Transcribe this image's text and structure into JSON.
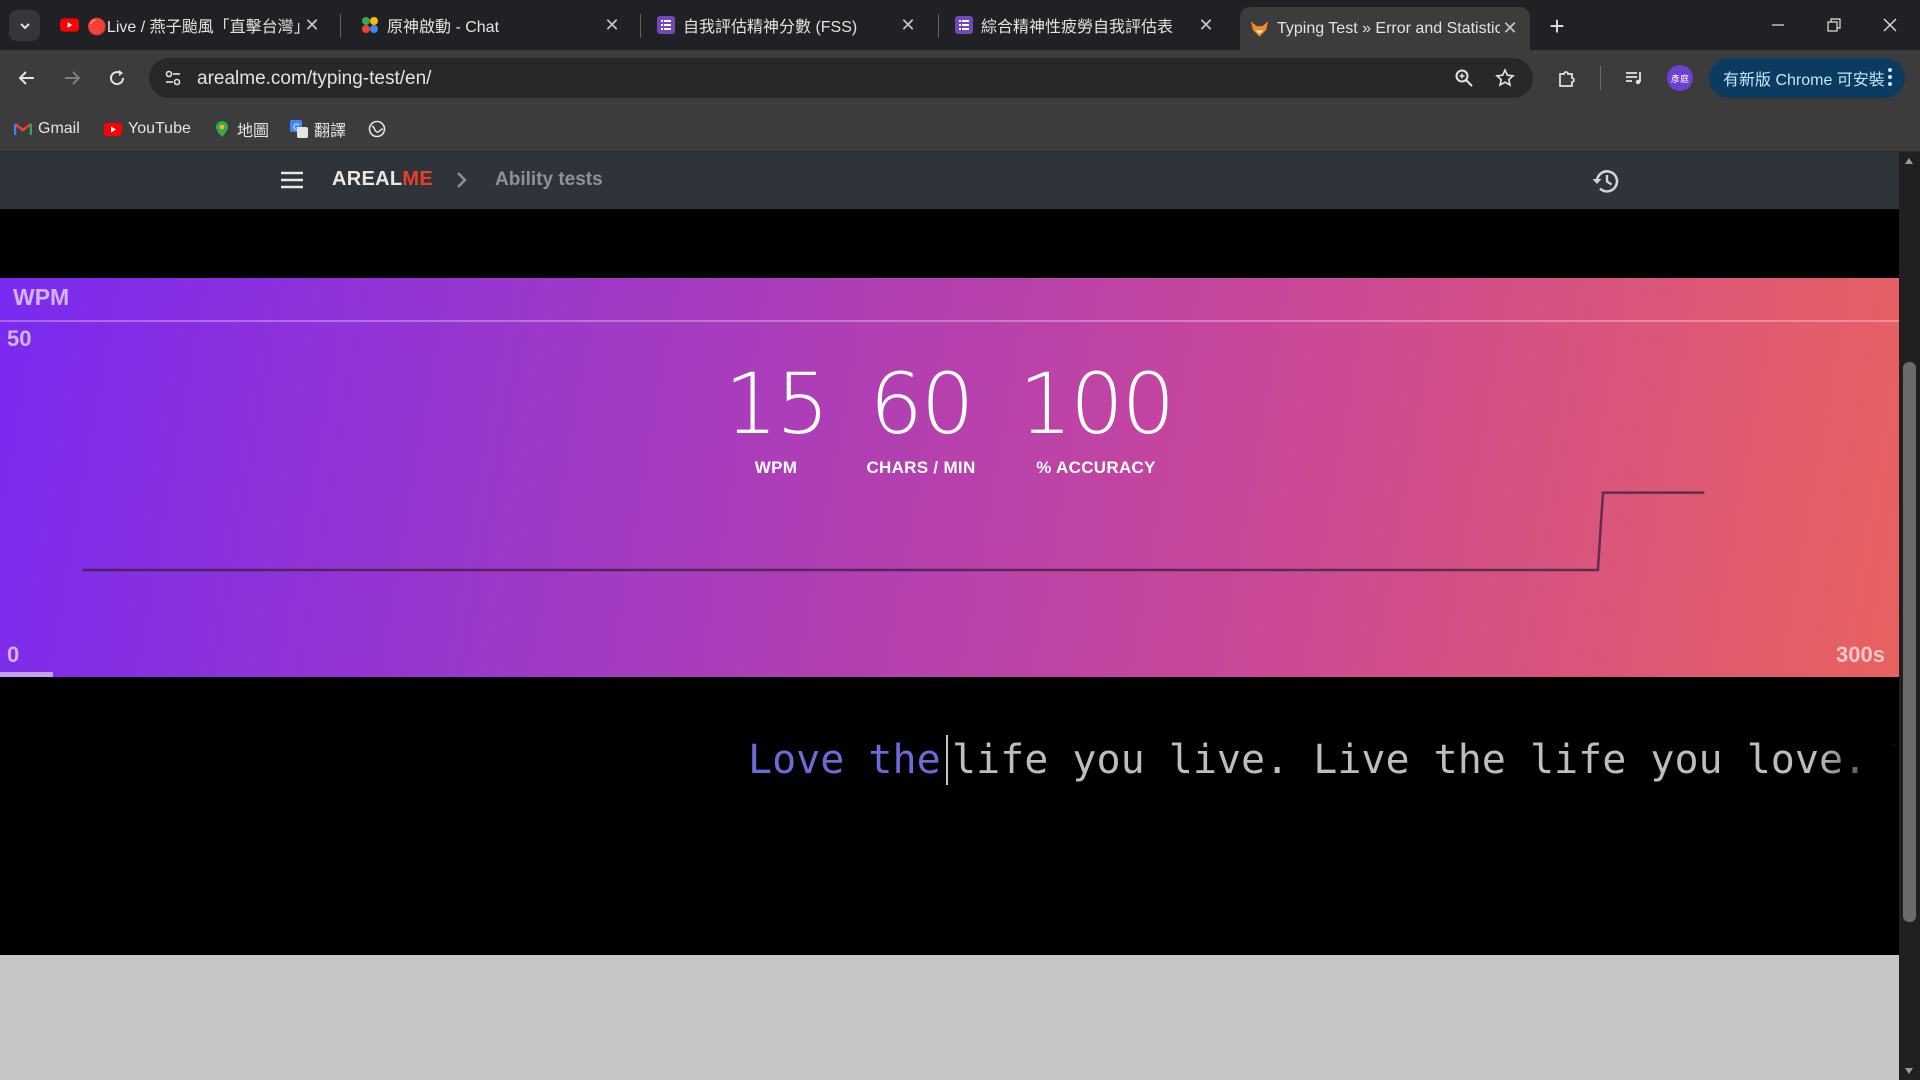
{
  "browser": {
    "tabs": [
      {
        "title": "🔴Live / 燕子颱風「直擊台灣」",
        "icon": "youtube-icon"
      },
      {
        "title": "原神啟動 - Chat",
        "icon": "chat-app-icon"
      },
      {
        "title": "自我評估精神分數 (FSS)",
        "icon": "forms-icon"
      },
      {
        "title": "綜合精神性疲勞自我評估表",
        "icon": "forms-icon"
      },
      {
        "title": "Typing Test » Error and Statistic",
        "icon": "fox-icon"
      }
    ],
    "address": "arealme.com/typing-test/en/",
    "update_label": "有新版 Chrome 可安裝",
    "profile_initials": "彥庭",
    "bookmarks": [
      {
        "label": "Gmail",
        "icon": "gmail-icon"
      },
      {
        "label": "YouTube",
        "icon": "youtube-icon"
      },
      {
        "label": "地圖",
        "icon": "maps-icon"
      },
      {
        "label": "翻譯",
        "icon": "translate-icon"
      },
      {
        "label": "",
        "icon": "globe-icon"
      }
    ]
  },
  "site": {
    "brand_main": "AREAL",
    "brand_accent": "ME",
    "breadcrumb": "Ability tests"
  },
  "stats": {
    "panel_label": "WPM",
    "y_max": "50",
    "y_min": "0",
    "x_end": "300s",
    "wpm": {
      "value": "15",
      "label": "WPM"
    },
    "cpm": {
      "value": "60",
      "label": "CHARS / MIN"
    },
    "accuracy": {
      "value": "100",
      "label": "% ACCURACY"
    },
    "elapsed_fraction": 0.028
  },
  "chart_data": {
    "type": "line",
    "x_unit": "s",
    "xlim": [
      0,
      300
    ],
    "ylim": [
      0,
      50
    ],
    "series": [
      {
        "x": [
          0,
          299,
          300,
          320
        ],
        "y": [
          0,
          0,
          15,
          15
        ]
      }
    ]
  },
  "typing": {
    "typed": "Love the ",
    "remaining": "life you live. Live the life you love. The"
  },
  "colors": {
    "brand_accent": "#e8402a",
    "typed_text": "#6e6ad8",
    "gradient_start": "#7a2af0",
    "gradient_end": "#e8625f"
  }
}
